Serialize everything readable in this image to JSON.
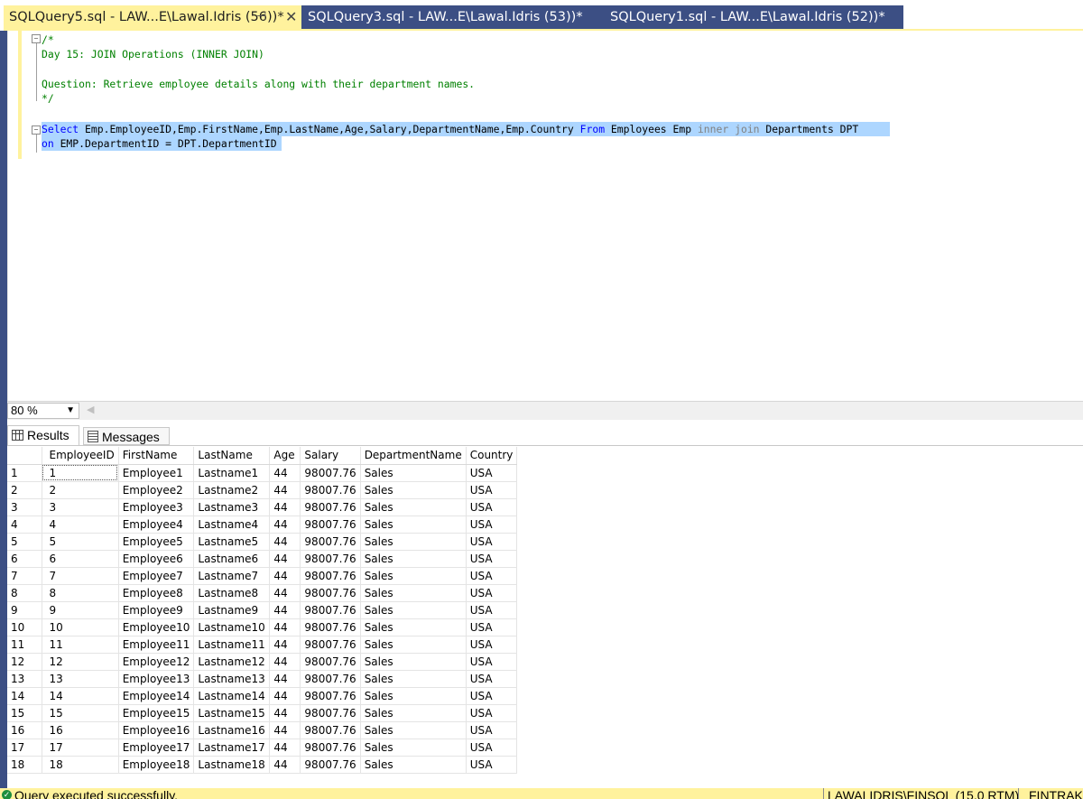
{
  "tabs": [
    {
      "label": "SQLQuery5.sql - LAW...E\\Lawal.Idris (56))*",
      "active": true
    },
    {
      "label": "SQLQuery3.sql - LAW...E\\Lawal.Idris (53))*",
      "active": false
    },
    {
      "label": "SQLQuery1.sql - LAW...E\\Lawal.Idris (52))*",
      "active": false
    }
  ],
  "tab_pin_icon": "pin-icon",
  "tab_close_icon": "close-icon",
  "editor": {
    "comment_open": "/*",
    "comment_line1": "Day 15: JOIN Operations (INNER JOIN)",
    "comment_line2": "Question: Retrieve employee details along with their department names.",
    "comment_close": "*/",
    "sql_select": "Select",
    "sql_columns": " Emp.EmployeeID,Emp.FirstName,Emp.LastName,Age,Salary,DepartmentName,Emp.Country ",
    "sql_from": "From",
    "sql_table1": " Employees Emp ",
    "sql_inner_join": "inner join",
    "sql_table2": " Departments DPT",
    "sql_on": "on",
    "sql_condition": " EMP.DepartmentID = DPT.DepartmentID"
  },
  "zoom": {
    "value": "80 %"
  },
  "results_tabs": {
    "results": "Results",
    "messages": "Messages"
  },
  "grid": {
    "columns": [
      "EmployeeID",
      "FirstName",
      "LastName",
      "Age",
      "Salary",
      "DepartmentName",
      "Country"
    ],
    "rows": [
      [
        "1",
        "1",
        "Employee1",
        "Lastname1",
        "44",
        "98007.76",
        "Sales",
        "USA"
      ],
      [
        "2",
        "2",
        "Employee2",
        "Lastname2",
        "44",
        "98007.76",
        "Sales",
        "USA"
      ],
      [
        "3",
        "3",
        "Employee3",
        "Lastname3",
        "44",
        "98007.76",
        "Sales",
        "USA"
      ],
      [
        "4",
        "4",
        "Employee4",
        "Lastname4",
        "44",
        "98007.76",
        "Sales",
        "USA"
      ],
      [
        "5",
        "5",
        "Employee5",
        "Lastname5",
        "44",
        "98007.76",
        "Sales",
        "USA"
      ],
      [
        "6",
        "6",
        "Employee6",
        "Lastname6",
        "44",
        "98007.76",
        "Sales",
        "USA"
      ],
      [
        "7",
        "7",
        "Employee7",
        "Lastname7",
        "44",
        "98007.76",
        "Sales",
        "USA"
      ],
      [
        "8",
        "8",
        "Employee8",
        "Lastname8",
        "44",
        "98007.76",
        "Sales",
        "USA"
      ],
      [
        "9",
        "9",
        "Employee9",
        "Lastname9",
        "44",
        "98007.76",
        "Sales",
        "USA"
      ],
      [
        "10",
        "10",
        "Employee10",
        "Lastname10",
        "44",
        "98007.76",
        "Sales",
        "USA"
      ],
      [
        "11",
        "11",
        "Employee11",
        "Lastname11",
        "44",
        "98007.76",
        "Sales",
        "USA"
      ],
      [
        "12",
        "12",
        "Employee12",
        "Lastname12",
        "44",
        "98007.76",
        "Sales",
        "USA"
      ],
      [
        "13",
        "13",
        "Employee13",
        "Lastname13",
        "44",
        "98007.76",
        "Sales",
        "USA"
      ],
      [
        "14",
        "14",
        "Employee14",
        "Lastname14",
        "44",
        "98007.76",
        "Sales",
        "USA"
      ],
      [
        "15",
        "15",
        "Employee15",
        "Lastname15",
        "44",
        "98007.76",
        "Sales",
        "USA"
      ],
      [
        "16",
        "16",
        "Employee16",
        "Lastname16",
        "44",
        "98007.76",
        "Sales",
        "USA"
      ],
      [
        "17",
        "17",
        "Employee17",
        "Lastname17",
        "44",
        "98007.76",
        "Sales",
        "USA"
      ],
      [
        "18",
        "18",
        "Employee18",
        "Lastname18",
        "44",
        "98007.76",
        "Sales",
        "USA"
      ]
    ]
  },
  "status": {
    "message": "Query executed successfully.",
    "server": "LAWALIDRIS\\FINSQL (15.0 RTM)",
    "database": "FINTRAK"
  },
  "colors": {
    "accent_yellow": "#fff29d",
    "tab_inactive": "#3c4f84",
    "selection": "#add6ff",
    "comment": "#008000",
    "keyword": "#0000ff"
  }
}
